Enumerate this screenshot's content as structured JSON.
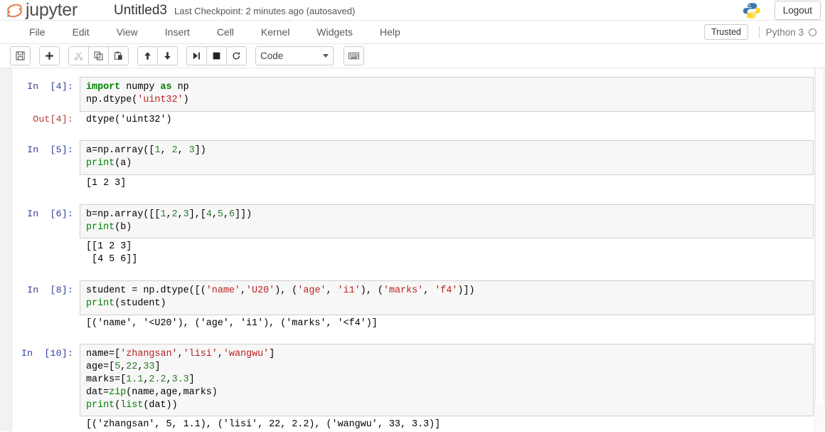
{
  "header": {
    "logo_text": "jupyter",
    "notebook_name": "Untitled3",
    "checkpoint": "Last Checkpoint: 2 minutes ago (autosaved)",
    "logout_label": "Logout",
    "python_logo_icon": "python-logo-icon"
  },
  "menubar": {
    "items": [
      {
        "label": "File"
      },
      {
        "label": "Edit"
      },
      {
        "label": "View"
      },
      {
        "label": "Insert"
      },
      {
        "label": "Cell"
      },
      {
        "label": "Kernel"
      },
      {
        "label": "Widgets"
      },
      {
        "label": "Help"
      }
    ],
    "trusted_label": "Trusted",
    "kernel_name": "Python 3",
    "kernel_status": "idle"
  },
  "toolbar": {
    "buttons": [
      {
        "name": "save-button",
        "icon": "floppy-disk-icon",
        "glyph": "⬒",
        "disabled": false
      },
      {
        "name": "insert-cell-below-button",
        "icon": "plus-icon",
        "glyph": "＋",
        "disabled": false
      },
      {
        "name": "cut-cell-button",
        "icon": "scissors-icon",
        "glyph": "✂",
        "disabled": true
      },
      {
        "name": "copy-cell-button",
        "icon": "copy-icon",
        "glyph": "⧉",
        "disabled": false
      },
      {
        "name": "paste-cell-button",
        "icon": "clipboard-icon",
        "glyph": "Ὄb",
        "disabled": false
      },
      {
        "name": "move-cell-up-button",
        "icon": "arrow-up-icon",
        "glyph": "↑",
        "disabled": false
      },
      {
        "name": "move-cell-down-button",
        "icon": "arrow-down-icon",
        "glyph": "↓",
        "disabled": false
      },
      {
        "name": "run-cell-button",
        "icon": "run-icon",
        "glyph": "▶|",
        "disabled": false
      },
      {
        "name": "interrupt-kernel-button",
        "icon": "stop-square-icon",
        "glyph": "■",
        "disabled": false
      },
      {
        "name": "restart-kernel-button",
        "icon": "restart-icon",
        "glyph": "↻",
        "disabled": false
      }
    ],
    "celltype_value": "Code",
    "command_palette_icon": "keyboard-icon"
  },
  "notebook": {
    "cells": [
      {
        "prompt": "In  [4]:",
        "source_html": "<span class=\"kw\">import</span> numpy <span class=\"kw\">as</span> np\nnp.dtype(<span class=\"str\">'uint32'</span>)",
        "source_text": "import numpy as np\nnp.dtype('uint32')",
        "output_prompt": "Out[4]:",
        "output_text": "dtype('uint32')"
      },
      {
        "prompt": "In  [5]:",
        "source_html": "a=np.array([<span class=\"num\">1</span>, <span class=\"num\">2</span>, <span class=\"num\">3</span>])\n<span class=\"bi\">print</span>(a)",
        "source_text": "a=np.array([1, 2, 3])\nprint(a)",
        "output_prompt": "",
        "output_text": "[1 2 3]"
      },
      {
        "prompt": "In  [6]:",
        "source_html": "b=np.array([[<span class=\"num\">1</span>,<span class=\"num\">2</span>,<span class=\"num\">3</span>],[<span class=\"num\">4</span>,<span class=\"num\">5</span>,<span class=\"num\">6</span>]])\n<span class=\"bi\">print</span>(b)",
        "source_text": "b=np.array([[1,2,3],[4,5,6]])\nprint(b)",
        "output_prompt": "",
        "output_text": "[[1 2 3]\n [4 5 6]]"
      },
      {
        "prompt": "In  [8]:",
        "source_html": "student = np.dtype([(<span class=\"str\">'name'</span>,<span class=\"str\">'U20'</span>), (<span class=\"str\">'age'</span>, <span class=\"str\">'i1'</span>), (<span class=\"str\">'marks'</span>, <span class=\"str\">'f4'</span>)])\n<span class=\"bi\">print</span>(student)",
        "source_text": "student = np.dtype([('name','U20'), ('age', 'i1'), ('marks', 'f4')])\nprint(student)",
        "output_prompt": "",
        "output_text": "[('name', '<U20'), ('age', 'i1'), ('marks', '<f4')]"
      },
      {
        "prompt": "In  [10]:",
        "source_html": "name=[<span class=\"str\">'zhangsan'</span>,<span class=\"str\">'lisi'</span>,<span class=\"str\">'wangwu'</span>]\nage=[<span class=\"num\">5</span>,<span class=\"num\">22</span>,<span class=\"num\">33</span>]\nmarks=[<span class=\"num\">1.1</span>,<span class=\"num\">2.2</span>,<span class=\"num\">3.3</span>]\ndat=<span class=\"bi\">zip</span>(name,age,marks)\n<span class=\"bi\">print</span>(<span class=\"bi\">list</span>(dat))",
        "source_text": "name=['zhangsan','lisi','wangwu']\nage=[5,22,33]\nmarks=[1.1,2.2,3.3]\ndat=zip(name,age,marks)\nprint(list(dat))",
        "output_prompt": "",
        "output_text": "[('zhangsan', 5, 1.1), ('lisi', 22, 2.2), ('wangwu', 33, 3.3)]"
      }
    ]
  },
  "colors": {
    "accent_orange": "#e8743b",
    "prompt_in": "#303f9f",
    "prompt_out": "#b33a3a",
    "string": "#ba2121",
    "keyword": "#008000",
    "number": "#2a7a2a",
    "cell_bg": "#f7f7f7",
    "cell_border": "#cfcfcf"
  }
}
